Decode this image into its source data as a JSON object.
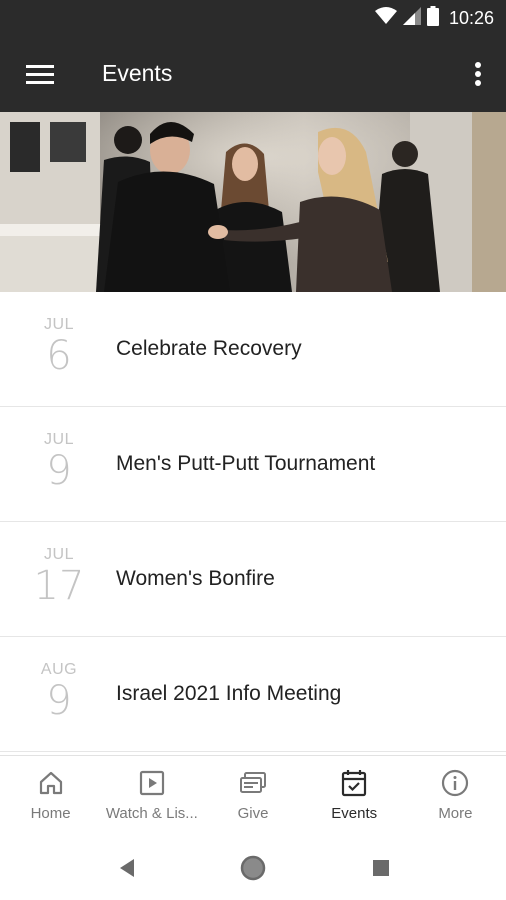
{
  "status_bar": {
    "time": "10:26",
    "icons": [
      "wifi-icon",
      "signal-icon",
      "battery-icon"
    ]
  },
  "app_bar": {
    "title": "Events",
    "menu_icon": "hamburger-menu-icon",
    "overflow_icon": "more-vert-icon"
  },
  "hero": {
    "description_icon": "event-banner-photo"
  },
  "events": [
    {
      "month": "JUL",
      "day": "6",
      "title": "Celebrate Recovery"
    },
    {
      "month": "JUL",
      "day": "9",
      "title": "Men's Putt-Putt Tournament"
    },
    {
      "month": "JUL",
      "day": "17",
      "title": "Women's Bonfire"
    },
    {
      "month": "AUG",
      "day": "9",
      "title": "Israel 2021 Info Meeting"
    }
  ],
  "bottom_nav": {
    "items": [
      {
        "label": "Home",
        "icon": "home-icon",
        "active": false
      },
      {
        "label": "Watch & Lis...",
        "icon": "play-icon",
        "active": false
      },
      {
        "label": "Give",
        "icon": "give-icon",
        "active": false
      },
      {
        "label": "Events",
        "icon": "calendar-check-icon",
        "active": true
      },
      {
        "label": "More",
        "icon": "info-icon",
        "active": false
      }
    ]
  },
  "colors": {
    "bar": "#2b2b2b",
    "active": "#2b2b2b",
    "inactive": "#7a7a7a",
    "date": "#c4c4c4"
  }
}
